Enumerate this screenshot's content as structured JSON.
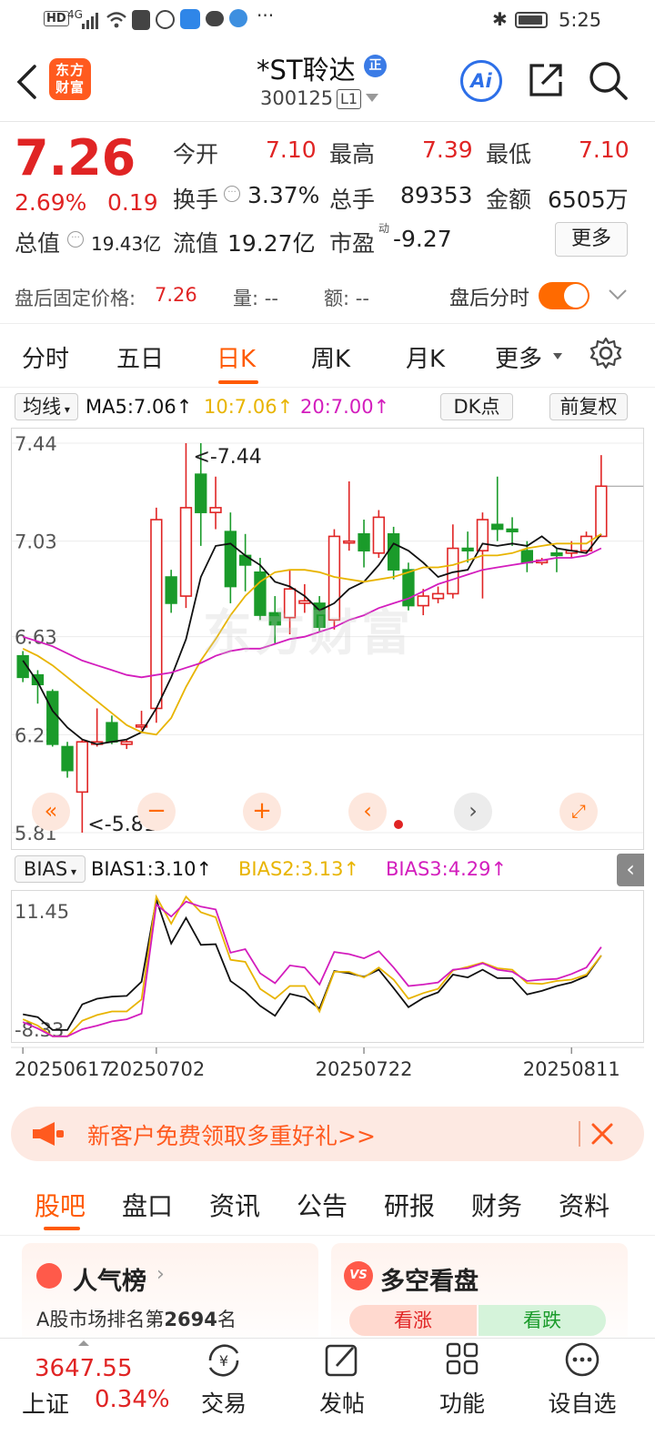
{
  "status": {
    "time": "5:25",
    "network": "4G"
  },
  "header": {
    "stock_name": "*ST聆达",
    "stock_code": "300125",
    "level_badge": "L1",
    "badge": "正",
    "logo_text": "东方财富",
    "ai_label": "Ai"
  },
  "quote": {
    "price": "7.26",
    "change_pct": "2.69%",
    "change_amt": "0.19",
    "open_label": "今开",
    "open": "7.10",
    "high_label": "最高",
    "high": "7.39",
    "low_label": "最低",
    "low": "7.10",
    "turnover_label": "换手",
    "turnover": "3.37%",
    "volume_label": "总手",
    "volume": "89353",
    "amount_label": "金额",
    "amount": "6505万",
    "mktcap_label": "总值",
    "mktcap": "19.43亿",
    "float_label": "流值",
    "float": "19.27亿",
    "pe_label": "市盈",
    "pe_sup": "动",
    "pe": "-9.27",
    "more_label": "更多"
  },
  "afterhours": {
    "fixed_label": "盘后固定价格:",
    "fixed_price": "7.26",
    "vol_label": "量: --",
    "amt_label": "额: --",
    "toggle_label": "盘后分时"
  },
  "tabs": [
    "分时",
    "五日",
    "日K",
    "周K",
    "月K",
    "更多"
  ],
  "active_tab": 2,
  "ma_row": {
    "selector": "均线",
    "ma5": "MA5:7.06",
    "ma10": "10:7.06",
    "ma20": "20:7.00",
    "dk": "DK点",
    "adjust": "前复权"
  },
  "bias_row": {
    "selector": "BIAS",
    "bias1": "BIAS1:3.10",
    "bias2": "BIAS2:3.13",
    "bias3": "BIAS3:4.29"
  },
  "watermark": "东方财富",
  "chart_data": [
    {
      "type": "candlestick",
      "y_ticks": [
        "7.44",
        "7.03",
        "6.63",
        "6.22",
        "5.81"
      ],
      "ylim": [
        5.81,
        7.44
      ],
      "annotations": {
        "max": "<-7.44",
        "min": "<-5.81"
      },
      "candles": [
        {
          "o": 6.55,
          "c": 6.46,
          "h": 6.57,
          "l": 6.44
        },
        {
          "o": 6.47,
          "c": 6.43,
          "h": 6.49,
          "l": 6.35
        },
        {
          "o": 6.4,
          "c": 6.18,
          "h": 6.41,
          "l": 6.17
        },
        {
          "o": 6.17,
          "c": 6.07,
          "h": 6.19,
          "l": 6.04
        },
        {
          "o": 5.98,
          "c": 6.19,
          "h": 6.2,
          "l": 5.81
        },
        {
          "o": 6.18,
          "c": 6.19,
          "h": 6.33,
          "l": 6.17
        },
        {
          "o": 6.27,
          "c": 6.19,
          "h": 6.3,
          "l": 6.18
        },
        {
          "o": 6.18,
          "c": 6.19,
          "h": 6.2,
          "l": 6.16
        },
        {
          "o": 6.26,
          "c": 6.26,
          "h": 6.32,
          "l": 6.24
        },
        {
          "o": 6.33,
          "c": 7.12,
          "h": 7.17,
          "l": 6.27
        },
        {
          "o": 6.88,
          "c": 6.77,
          "h": 6.91,
          "l": 6.73
        },
        {
          "o": 6.8,
          "c": 7.17,
          "h": 7.44,
          "l": 6.75
        },
        {
          "o": 7.31,
          "c": 7.15,
          "h": 7.44,
          "l": 7.01
        },
        {
          "o": 7.15,
          "c": 7.17,
          "h": 7.3,
          "l": 7.08
        },
        {
          "o": 7.07,
          "c": 6.84,
          "h": 7.15,
          "l": 6.77
        },
        {
          "o": 6.97,
          "c": 6.93,
          "h": 7.06,
          "l": 6.82
        },
        {
          "o": 6.9,
          "c": 6.72,
          "h": 6.96,
          "l": 6.7
        },
        {
          "o": 6.73,
          "c": 6.68,
          "h": 6.8,
          "l": 6.6
        },
        {
          "o": 6.71,
          "c": 6.83,
          "h": 6.91,
          "l": 6.64
        },
        {
          "o": 6.77,
          "c": 6.78,
          "h": 6.85,
          "l": 6.73
        },
        {
          "o": 6.77,
          "c": 6.67,
          "h": 6.8,
          "l": 6.65
        },
        {
          "o": 6.7,
          "c": 7.05,
          "h": 7.08,
          "l": 6.66
        },
        {
          "o": 7.03,
          "c": 7.03,
          "h": 7.28,
          "l": 6.99
        },
        {
          "o": 7.06,
          "c": 6.99,
          "h": 7.12,
          "l": 6.92
        },
        {
          "o": 6.98,
          "c": 7.13,
          "h": 7.16,
          "l": 6.96
        },
        {
          "o": 7.06,
          "c": 6.91,
          "h": 7.09,
          "l": 6.87
        },
        {
          "o": 6.91,
          "c": 6.76,
          "h": 6.94,
          "l": 6.74
        },
        {
          "o": 6.76,
          "c": 6.8,
          "h": 6.83,
          "l": 6.72
        },
        {
          "o": 6.79,
          "c": 6.81,
          "h": 6.84,
          "l": 6.77
        },
        {
          "o": 6.81,
          "c": 7.0,
          "h": 7.1,
          "l": 6.79
        },
        {
          "o": 7.0,
          "c": 6.99,
          "h": 7.07,
          "l": 6.94
        },
        {
          "o": 6.99,
          "c": 7.12,
          "h": 7.15,
          "l": 6.79
        },
        {
          "o": 7.1,
          "c": 7.08,
          "h": 7.3,
          "l": 7.03
        },
        {
          "o": 7.08,
          "c": 7.07,
          "h": 7.13,
          "l": 7.01
        },
        {
          "o": 6.99,
          "c": 6.94,
          "h": 7.03,
          "l": 6.9
        },
        {
          "o": 6.94,
          "c": 6.95,
          "h": 6.96,
          "l": 6.93
        },
        {
          "o": 6.98,
          "c": 6.97,
          "h": 7.0,
          "l": 6.9
        },
        {
          "o": 6.98,
          "c": 6.99,
          "h": 7.03,
          "l": 6.96
        },
        {
          "o": 6.99,
          "c": 7.05,
          "h": 7.07,
          "l": 6.98
        },
        {
          "o": 7.05,
          "c": 7.26,
          "h": 7.39,
          "l": 7.1
        }
      ],
      "ma5": [
        6.53,
        6.44,
        6.32,
        6.25,
        6.2,
        6.18,
        6.19,
        6.2,
        6.23,
        6.33,
        6.46,
        6.62,
        6.88,
        7.01,
        7.02,
        6.97,
        6.93,
        6.86,
        6.84,
        6.8,
        6.74,
        6.77,
        6.83,
        6.86,
        6.93,
        7.02,
        6.99,
        6.94,
        6.88,
        6.9,
        6.91,
        7.02,
        7.01,
        7.02,
        7.01,
        7.05,
        7.0,
        6.99,
        6.98,
        7.06
      ],
      "ma10": [
        6.58,
        6.55,
        6.51,
        6.46,
        6.41,
        6.36,
        6.31,
        6.26,
        6.23,
        6.22,
        6.29,
        6.42,
        6.53,
        6.62,
        6.72,
        6.8,
        6.86,
        6.9,
        6.91,
        6.91,
        6.9,
        6.88,
        6.87,
        6.86,
        6.87,
        6.88,
        6.9,
        6.92,
        6.92,
        6.93,
        6.95,
        6.97,
        6.97,
        6.98,
        7.0,
        7.01,
        7.02,
        7.02,
        7.02,
        7.06
      ],
      "ma20": [
        6.63,
        6.61,
        6.59,
        6.56,
        6.53,
        6.51,
        6.49,
        6.47,
        6.46,
        6.47,
        6.48,
        6.5,
        6.52,
        6.55,
        6.57,
        6.58,
        6.58,
        6.6,
        6.62,
        6.63,
        6.65,
        6.67,
        6.7,
        6.72,
        6.75,
        6.77,
        6.79,
        6.82,
        6.85,
        6.87,
        6.89,
        6.91,
        6.92,
        6.93,
        6.94,
        6.95,
        6.96,
        6.96,
        6.97,
        7.0
      ]
    },
    {
      "type": "line",
      "y_ticks": [
        "11.45",
        "-8.33"
      ],
      "ylim": [
        -8.33,
        11.45
      ],
      "x_ticks": [
        {
          "index": 0,
          "label": "20250617"
        },
        {
          "index": 9,
          "label": "20250702"
        },
        {
          "index": 23,
          "label": "20250722"
        },
        {
          "index": 37,
          "label": "20250811"
        }
      ],
      "series": [
        {
          "name": "BIAS1",
          "color": "#111111",
          "values": [
            -5.2,
            -5.6,
            -7.4,
            -7.4,
            -3.8,
            -3.0,
            -2.7,
            -2.6,
            -0.6,
            11.0,
            4.8,
            8.4,
            4.6,
            4.7,
            -0.5,
            -2.0,
            -4.0,
            -5.4,
            -2.3,
            -2.8,
            -4.4,
            0.9,
            0.6,
            0.1,
            1.1,
            -1.5,
            -4.2,
            -2.9,
            -2.1,
            0.4,
            0.0,
            1.1,
            -0.1,
            -0.1,
            -2.4,
            -1.9,
            -1.2,
            -0.7,
            0.2,
            3.1
          ]
        },
        {
          "name": "BIAS2",
          "color": "#e8b400",
          "values": [
            -5.9,
            -6.8,
            -8.3,
            -8.3,
            -6.1,
            -5.3,
            -4.8,
            -4.8,
            -3.1,
            11.4,
            7.6,
            11.4,
            9.2,
            8.5,
            2.5,
            2.2,
            -1.6,
            -3.0,
            -1.2,
            -1.2,
            -4.8,
            0.8,
            0.8,
            0.0,
            1.4,
            -0.3,
            -3.0,
            -2.2,
            -1.6,
            1.0,
            1.5,
            2.1,
            1.3,
            1.1,
            -0.8,
            -0.9,
            -0.5,
            -0.3,
            0.4,
            3.1
          ]
        },
        {
          "name": "BIAS3",
          "color": "#d31dbd",
          "values": [
            -6.3,
            -7.2,
            -8.3,
            -8.3,
            -7.3,
            -6.8,
            -6.2,
            -5.9,
            -5.1,
            10.3,
            8.6,
            10.7,
            10.0,
            9.6,
            3.5,
            4.0,
            0.6,
            -0.8,
            1.7,
            1.4,
            -1.0,
            3.6,
            3.3,
            2.7,
            3.7,
            1.4,
            -1.2,
            -1.0,
            -0.7,
            1.1,
            1.3,
            2.0,
            1.1,
            0.8,
            -0.5,
            -0.3,
            -0.2,
            0.5,
            1.4,
            4.3
          ]
        }
      ]
    }
  ],
  "promo": {
    "text": "新客户免费领取多重好礼>>"
  },
  "subtabs": [
    "股吧",
    "盘口",
    "资讯",
    "公告",
    "研报",
    "财务",
    "资料"
  ],
  "cards": {
    "hot": {
      "title": "人气榜",
      "rank_prefix": "A股市场排名第",
      "rank": "2694",
      "rank_suffix": "名"
    },
    "vs": {
      "title": "多空看盘",
      "up": "看涨",
      "down": "看跌",
      "logo": "VS"
    }
  },
  "bottom": {
    "index_value": "3647.55",
    "index_name": "上证",
    "index_change": "0.34%",
    "nav": [
      {
        "label": "交易"
      },
      {
        "label": "发帖"
      },
      {
        "label": "功能"
      },
      {
        "label": "设自选"
      }
    ]
  },
  "colors": {
    "up": "#e02424",
    "down": "#1a9b2a",
    "accent": "#ff6a00",
    "ma5": "#111111",
    "ma10": "#e8b400",
    "ma20": "#d31dbd"
  }
}
